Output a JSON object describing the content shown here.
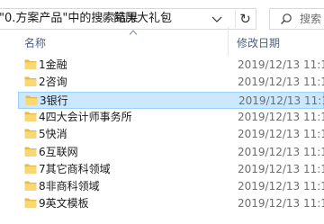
{
  "address": {
    "crumbs": [
      "\"0.方案产品\"中的搜索结果",
      "简历大礼包"
    ],
    "separator": "›",
    "refresh_icon": "↻"
  },
  "search": {
    "placeholder": "搜索"
  },
  "columns": {
    "name": "名称",
    "date": "修改日期"
  },
  "files": [
    {
      "name": "1金融",
      "date": "2019/12/13 11:18",
      "selected": false
    },
    {
      "name": "2咨询",
      "date": "2019/12/13 11:18",
      "selected": false
    },
    {
      "name": "3银行",
      "date": "2019/12/13 11:18",
      "selected": true
    },
    {
      "name": "4四大会计师事务所",
      "date": "2019/12/13 11:18",
      "selected": false
    },
    {
      "name": "5快消",
      "date": "2019/12/13 11:18",
      "selected": false
    },
    {
      "name": "6互联网",
      "date": "2019/12/13 11:18",
      "selected": false
    },
    {
      "name": "7其它商科领域",
      "date": "2019/12/13 11:18",
      "selected": false
    },
    {
      "name": "8非商科领域",
      "date": "2019/12/13 11:18",
      "selected": false
    },
    {
      "name": "9英文模板",
      "date": "2019/12/13 11:18",
      "selected": false
    }
  ],
  "colors": {
    "folder": "#f8d775",
    "folder_dark": "#e9b942",
    "selection": "#cce8ff",
    "header_text": "#4d6082"
  }
}
